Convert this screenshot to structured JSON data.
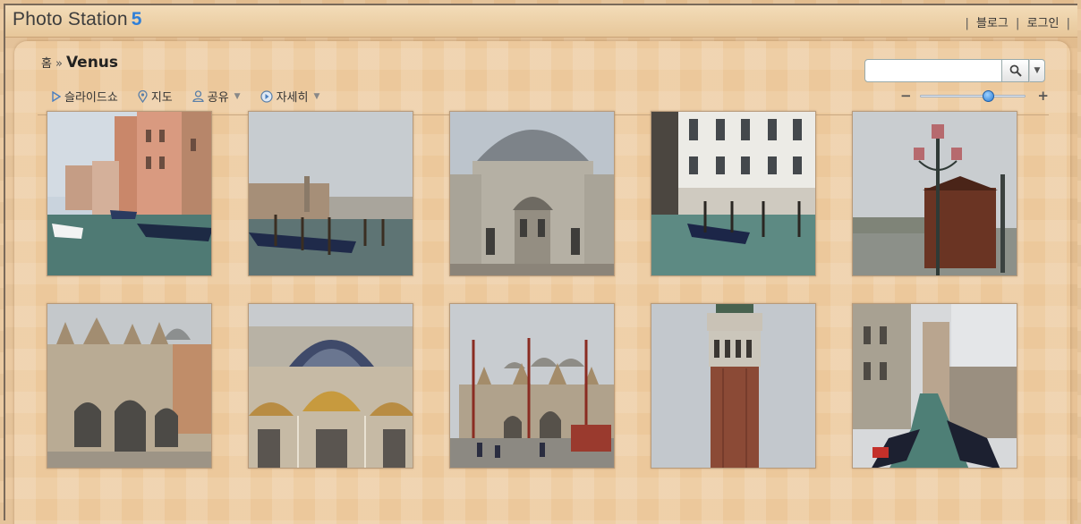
{
  "app": {
    "logo_text": "Photo Station",
    "logo_number": "5"
  },
  "top_links": {
    "blog": "블로그",
    "login": "로그인",
    "separator": "|"
  },
  "breadcrumb": {
    "home": "홈",
    "separator": "»",
    "current": "Venus"
  },
  "toolbar": {
    "slideshow": "슬라이드쇼",
    "map": "지도",
    "share": "공유",
    "details": "자세히"
  },
  "search": {
    "placeholder": "",
    "value": ""
  },
  "zoom": {
    "minus": "−",
    "plus": "+",
    "level_fraction": 0.65
  },
  "photos": [
    {
      "subject": "canal-buildings-gondolas"
    },
    {
      "subject": "grand-canal-gondolas"
    },
    {
      "subject": "domed-church-facade"
    },
    {
      "subject": "palazzo-gondolas"
    },
    {
      "subject": "lamp-post-kiosk"
    },
    {
      "subject": "basilica-facade"
    },
    {
      "subject": "basilica-mosaic-arches"
    },
    {
      "subject": "piazza-basilica"
    },
    {
      "subject": "campanile-tower"
    },
    {
      "subject": "narrow-canal-gondolas"
    }
  ],
  "colors": {
    "logo_accent": "#2f7fd8",
    "background": "#e8c396",
    "slider_thumb": "#2a7bd2"
  }
}
